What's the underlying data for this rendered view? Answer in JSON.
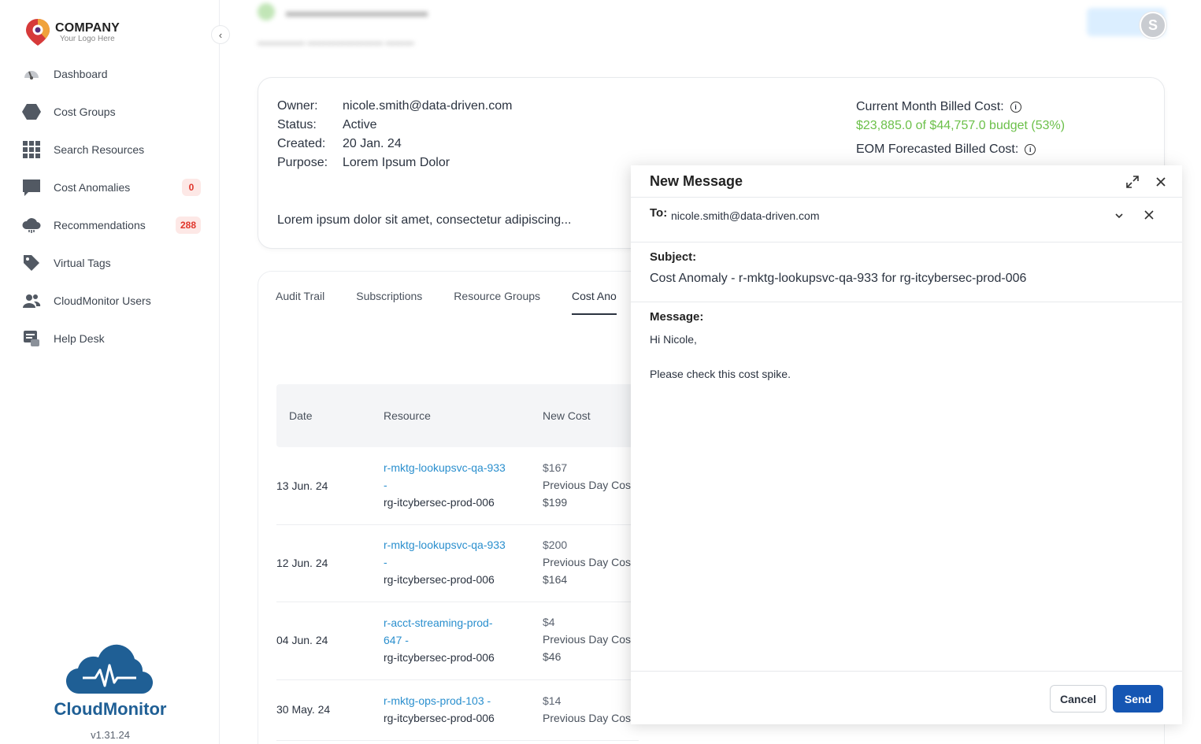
{
  "brand": {
    "name": "COMPANY",
    "tagline": "Your Logo Here"
  },
  "sidebar": {
    "items": [
      {
        "label": "Dashboard",
        "icon": "dashboard-gauge-icon"
      },
      {
        "label": "Cost Groups",
        "icon": "hexagon-icon"
      },
      {
        "label": "Search Resources",
        "icon": "grid-icon"
      },
      {
        "label": "Cost Anomalies",
        "icon": "chat-bubble-icon",
        "badge": "0"
      },
      {
        "label": "Recommendations",
        "icon": "cloud-icon",
        "badge": "288"
      },
      {
        "label": "Virtual Tags",
        "icon": "tag-icon"
      },
      {
        "label": "CloudMonitor Users",
        "icon": "users-icon"
      },
      {
        "label": "Help Desk",
        "icon": "help-desk-icon"
      }
    ],
    "product_name": "CloudMonitor",
    "version": "v1.31.24"
  },
  "header": {
    "avatar_initial": "S"
  },
  "info": {
    "owner_key": "Owner:",
    "owner": "nicole.smith@data-driven.com",
    "status_key": "Status:",
    "status": "Active",
    "created_key": "Created:",
    "created": "20 Jan. 24",
    "purpose_key": "Purpose:",
    "purpose": "Lorem Ipsum Dolor",
    "description": "Lorem ipsum dolor sit amet, consectetur adipiscing...",
    "current_cost_label": "Current Month Billed Cost:",
    "current_cost_value": "$23,885.0 of $44,757.0 budget (53%)",
    "eom_cost_label": "EOM Forecasted Billed Cost:"
  },
  "tabs": [
    "Audit Trail",
    "Subscriptions",
    "Resource Groups",
    "Cost Ano"
  ],
  "table": {
    "headers": [
      "Date",
      "Resource",
      "New Cost"
    ],
    "rows": [
      {
        "date": "13 Jun. 24",
        "res1": "r-mktg-lookupsvc-qa-933",
        "res2": "-",
        "rg": "rg-itcybersec-prod-006",
        "new_cost": "$167",
        "prev_label": "Previous Day Cos",
        "prev_cost": "$199"
      },
      {
        "date": "12 Jun. 24",
        "res1": "r-mktg-lookupsvc-qa-933",
        "res2": "-",
        "rg": "rg-itcybersec-prod-006",
        "new_cost": "$200",
        "prev_label": "Previous Day Cos",
        "prev_cost": "$164"
      },
      {
        "date": "04 Jun. 24",
        "res1": "r-acct-streaming-prod-",
        "res2": "647 -",
        "rg": "rg-itcybersec-prod-006",
        "new_cost": "$4",
        "prev_label": "Previous Day Cos",
        "prev_cost": "$46"
      },
      {
        "date": "30 May. 24",
        "res1": "r-mktg-ops-prod-103 -",
        "res2": "",
        "rg": "rg-itcybersec-prod-006",
        "new_cost": "$14",
        "prev_label": "Previous Day Cos",
        "prev_cost": ""
      }
    ]
  },
  "modal": {
    "title": "New Message",
    "to_label": "To:",
    "to_value": "nicole.smith@data-driven.com",
    "subject_label": "Subject:",
    "subject_value": "Cost Anomaly - r-mktg-lookupsvc-qa-933 for rg-itcybersec-prod-006",
    "message_label": "Message:",
    "message_line1": "Hi Nicole,",
    "message_line2": "Please check this cost spike.",
    "cancel_label": "Cancel",
    "send_label": "Send"
  },
  "colors": {
    "accent": "#1556b3",
    "link": "#2a8fce",
    "budget_green": "#6cc04a",
    "badge_red": "#e0352b"
  }
}
